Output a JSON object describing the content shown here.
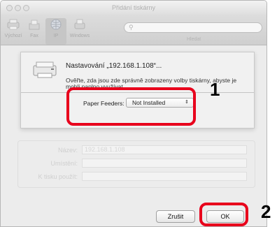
{
  "window": {
    "title": "Přidání tiskárny"
  },
  "toolbar": {
    "items": [
      {
        "label": "Výchozí",
        "icon": "default-printer-icon"
      },
      {
        "label": "Fax",
        "icon": "fax-icon"
      },
      {
        "label": "IP",
        "icon": "globe-icon"
      },
      {
        "label": "Windows",
        "icon": "windows-printer-icon"
      }
    ],
    "search_label": "Hledat"
  },
  "background_form": {
    "protocol_label": "Protok.",
    "address_label": "Název:",
    "address_value": "192.168.1.108",
    "location_label": "Umístění:",
    "use_label": "K tisku použít:"
  },
  "sheet": {
    "title": "Nastavování „192.168.1.108“...",
    "description": "Ověřte, zda jsou zde správně zobrazeny volby tiskárny, abyste je mohli naplno využívat.",
    "printer_feeders_label": "Paper Feeders:",
    "printer_feeders_value": "Not Installed"
  },
  "buttons": {
    "cancel_label": "Zrušit",
    "ok_label": "OK"
  },
  "callouts": {
    "step1": "1",
    "step2": "2"
  },
  "colors": {
    "highlight": "#e8001c"
  }
}
